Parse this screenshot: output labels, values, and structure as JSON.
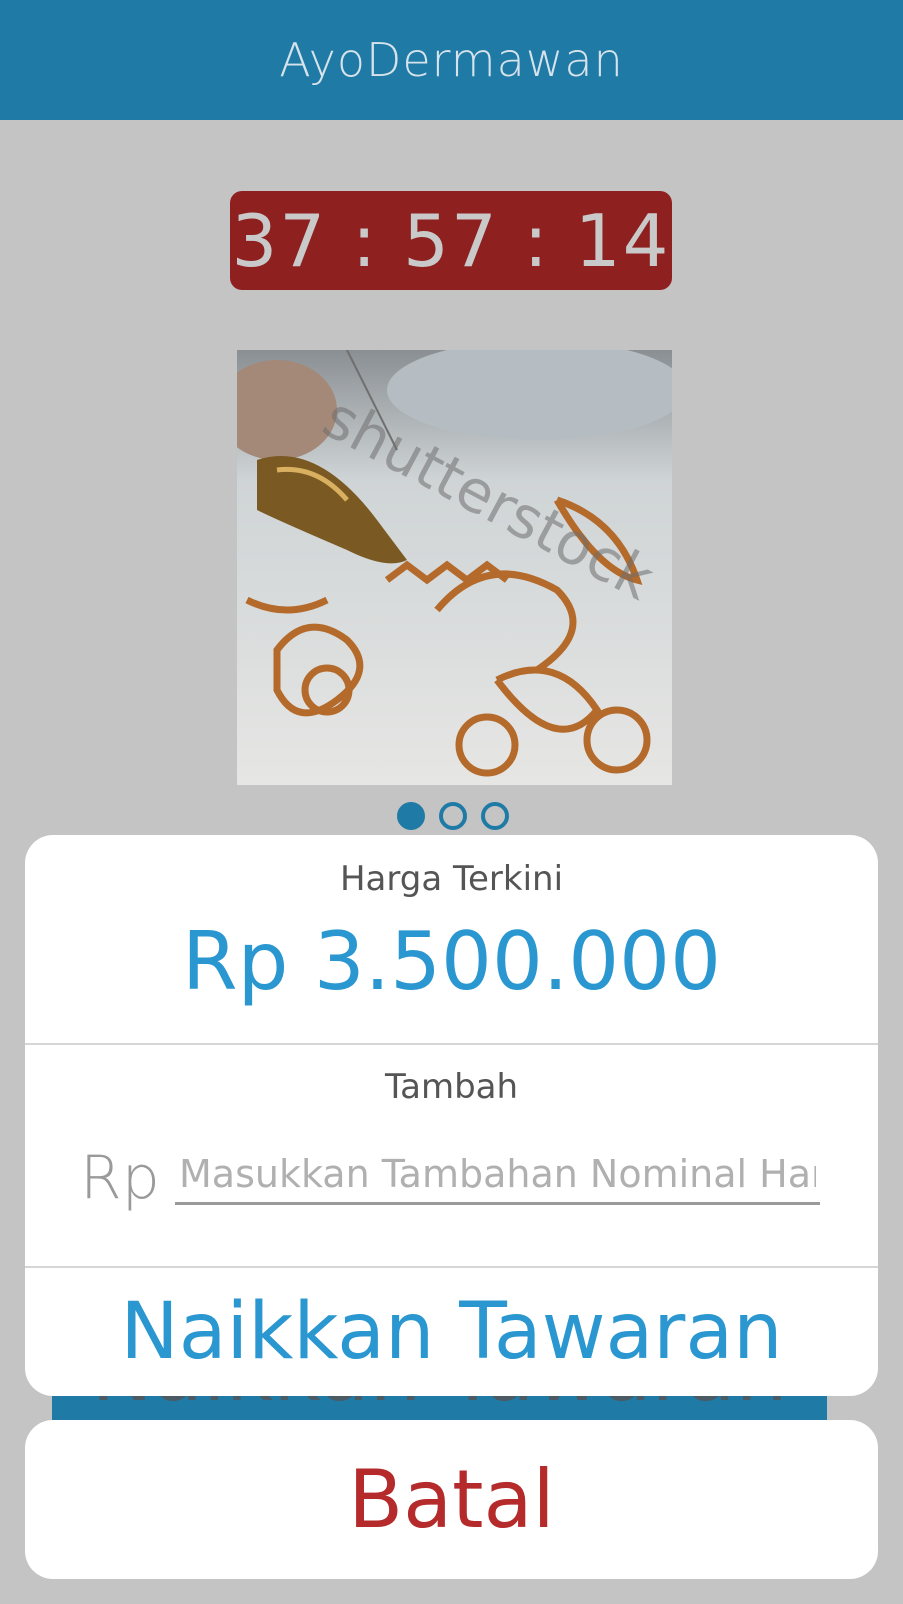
{
  "app": {
    "title": "AyoDermawan"
  },
  "timer": {
    "text": "37 : 57 : 14"
  },
  "carousel": {
    "total": 3,
    "active_index": 0,
    "watermark": "shutterstock"
  },
  "background_button": {
    "label": "Naikkan Tawaran"
  },
  "bid_sheet": {
    "current_price_label": "Harga Terkini",
    "current_price_value": "Rp 3.500.000",
    "add_label": "Tambah",
    "currency_prefix": "Rp",
    "amount_placeholder": "Masukkan Tambahan Nominal Harga",
    "amount_value": "",
    "raise_button_label": "Naikkan Tawaran"
  },
  "cancel": {
    "label": "Batal"
  },
  "colors": {
    "primary": "#1f7aa6",
    "accent_blue": "#2b97d1",
    "timer_bg": "#8e2020",
    "cancel_red": "#b52a2a",
    "background": "#c4c4c4"
  }
}
